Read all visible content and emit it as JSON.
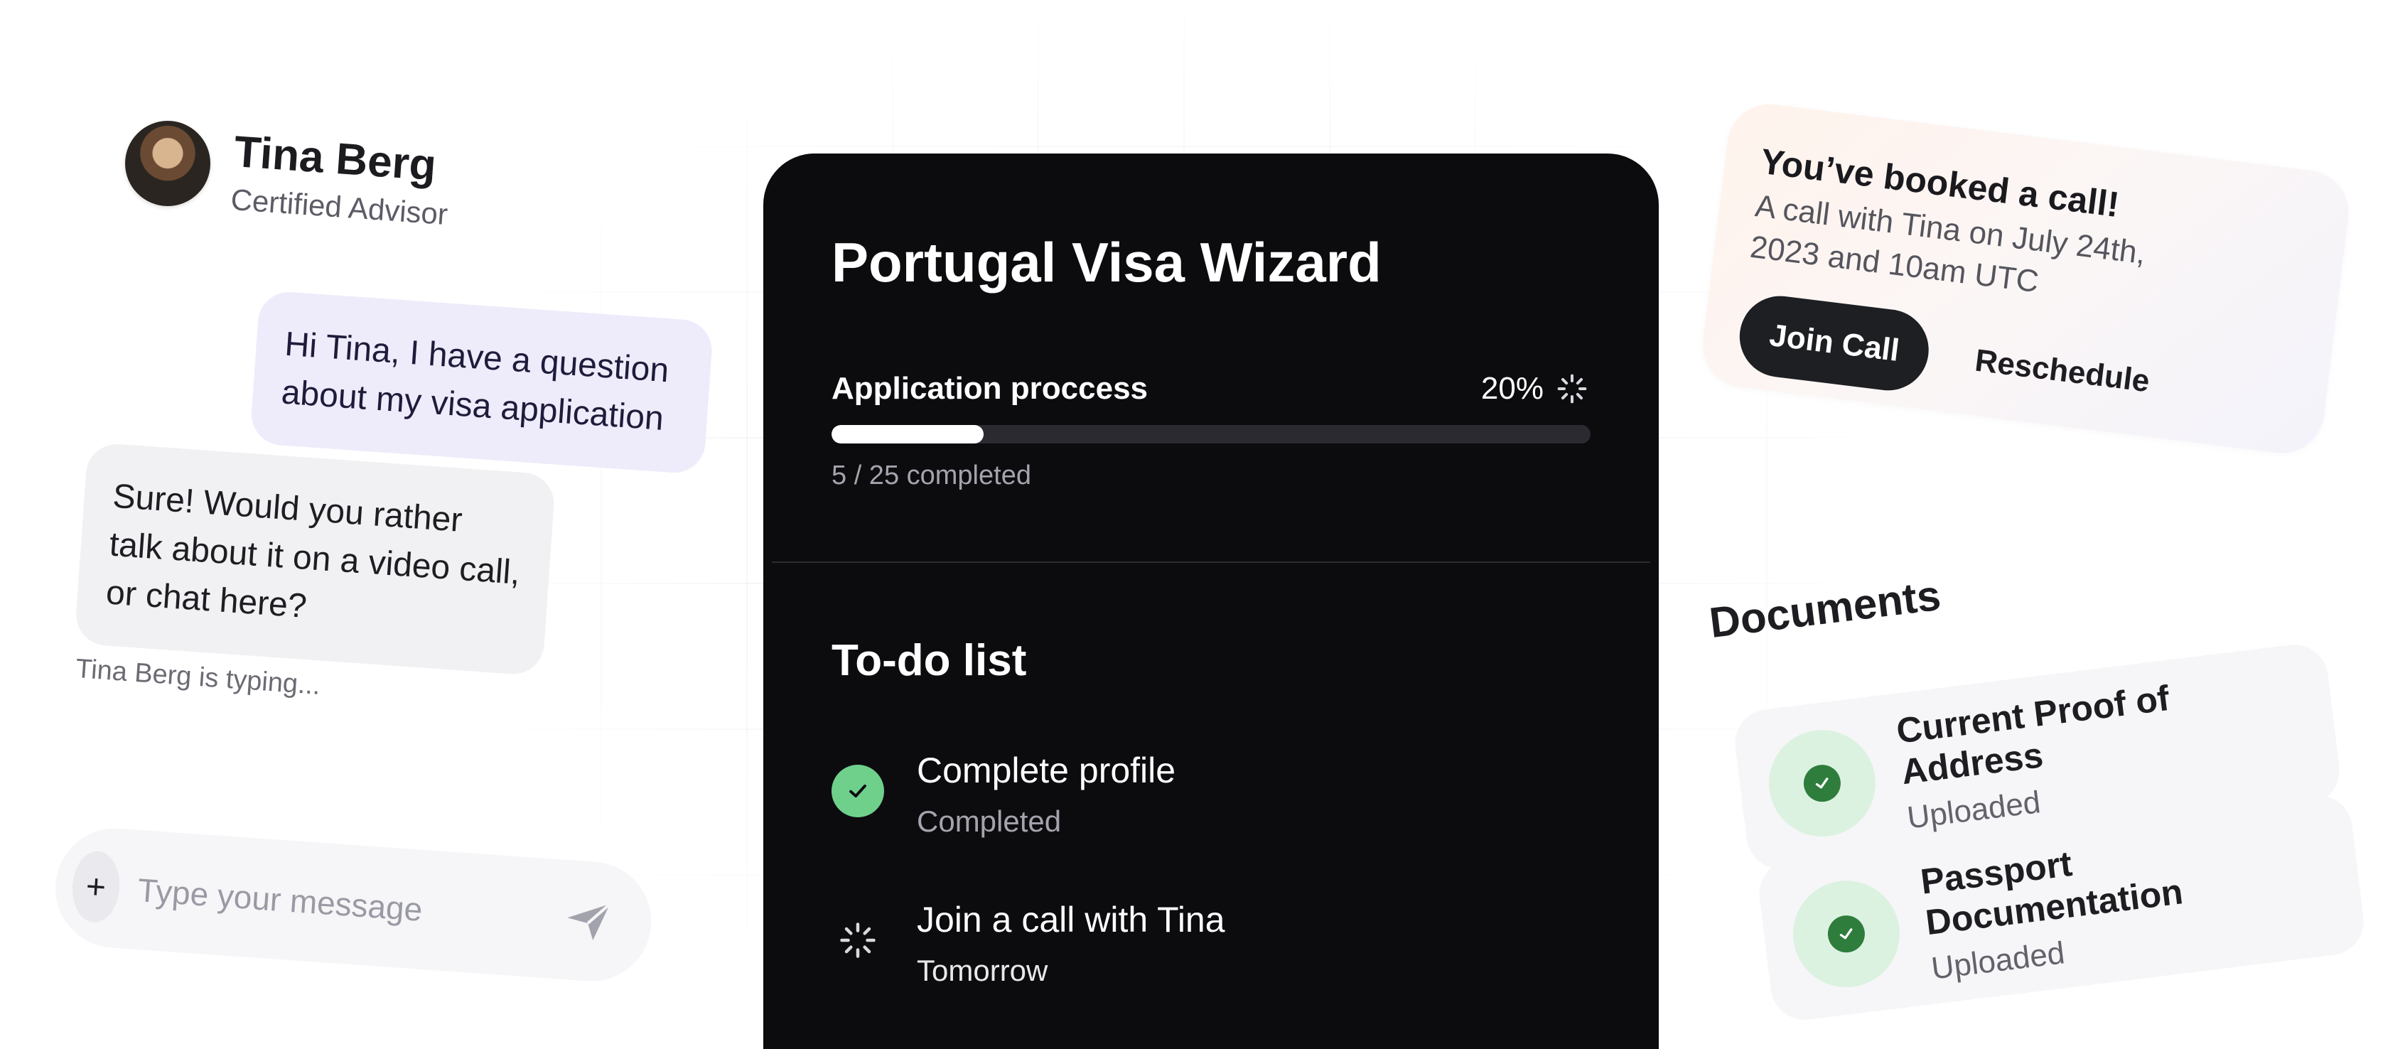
{
  "advisor": {
    "name": "Tina Berg",
    "role": "Certified Advisor"
  },
  "chat": {
    "messages": [
      {
        "from": "user",
        "text": "Hi Tina, I have a question about my visa application"
      },
      {
        "from": "advisor",
        "text": "Sure! Would you rather talk about it on a video call, or chat here?"
      }
    ],
    "typing_indicator": "Tina Berg is typing...",
    "input_placeholder": "Type your message",
    "attach_label": "+"
  },
  "wizard": {
    "title": "Portugal Visa Wizard",
    "progress_label": "Application proccess",
    "progress_percent_text": "20%",
    "progress_fraction": 0.2,
    "progress_count": "5 / 25 completed",
    "todo_title": "To-do list",
    "todos": [
      {
        "name": "Complete profile",
        "status": "Completed",
        "state": "done"
      },
      {
        "name": "Join a call with Tina",
        "status": "Tomorrow",
        "state": "pending"
      }
    ]
  },
  "booking": {
    "title": "You’ve booked a call!",
    "description": "A call with Tina on July 24th, 2023 and 10am UTC",
    "join_label": "Join Call",
    "reschedule_label": "Reschedule"
  },
  "documents": {
    "title": "Documents",
    "items": [
      {
        "name": "Current Proof of Address",
        "status": "Uploaded"
      },
      {
        "name": "Passport Documentation",
        "status": "Uploaded"
      }
    ]
  },
  "colors": {
    "card_dark": "#0c0c0f",
    "success_green": "#6fd08c",
    "doc_check_green": "#2e7d3c",
    "user_bubble": "#eeecfb"
  }
}
